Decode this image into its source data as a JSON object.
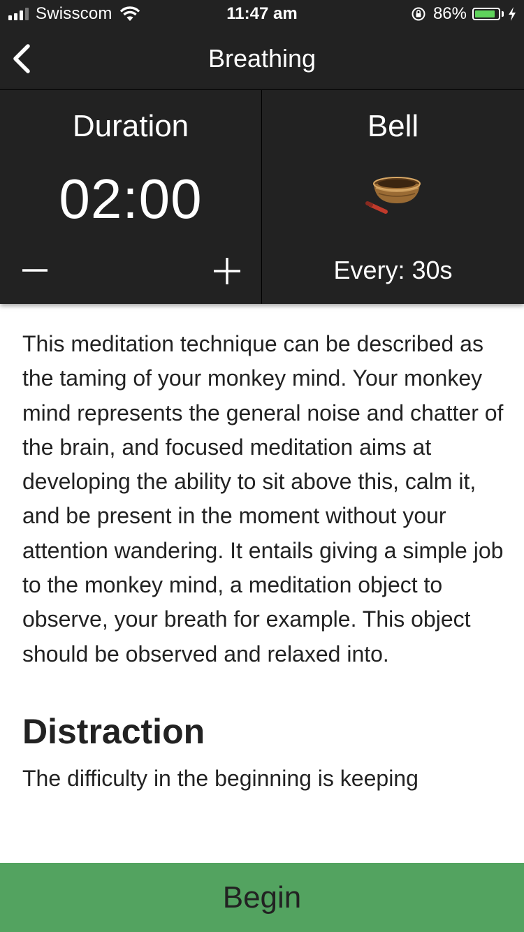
{
  "status_bar": {
    "carrier": "Swisscom",
    "time": "11:47 am",
    "battery_percent": "86%",
    "battery_level": 0.86,
    "signal_bars": 4,
    "signal_bars_active": 3
  },
  "nav": {
    "back_icon": "chevron-left-icon",
    "title": "Breathing"
  },
  "duration": {
    "label": "Duration",
    "value": "02:00",
    "decrease_icon": "minus-icon",
    "increase_icon": "plus-icon"
  },
  "bell": {
    "label": "Bell",
    "icon": "singing-bowl-icon",
    "interval": "Every: 30s"
  },
  "content": {
    "intro": "This meditation technique can be described as the taming of your monkey mind. Your monkey mind represents the general noise and chatter of the brain, and focused meditation aims at developing the ability to sit above this, calm it, and be present in the moment without your attention wandering. It entails giving a simple job to the monkey mind, a meditation object to observe, your breath for example. This object should be observed and relaxed into.",
    "heading": "Distraction",
    "paragraph2": "The difficulty in the beginning is keeping"
  },
  "begin_label": "Begin",
  "colors": {
    "header_bg": "#222222",
    "begin_bg": "#53a360",
    "battery_fill": "#5fd35b",
    "text": "#222222"
  }
}
